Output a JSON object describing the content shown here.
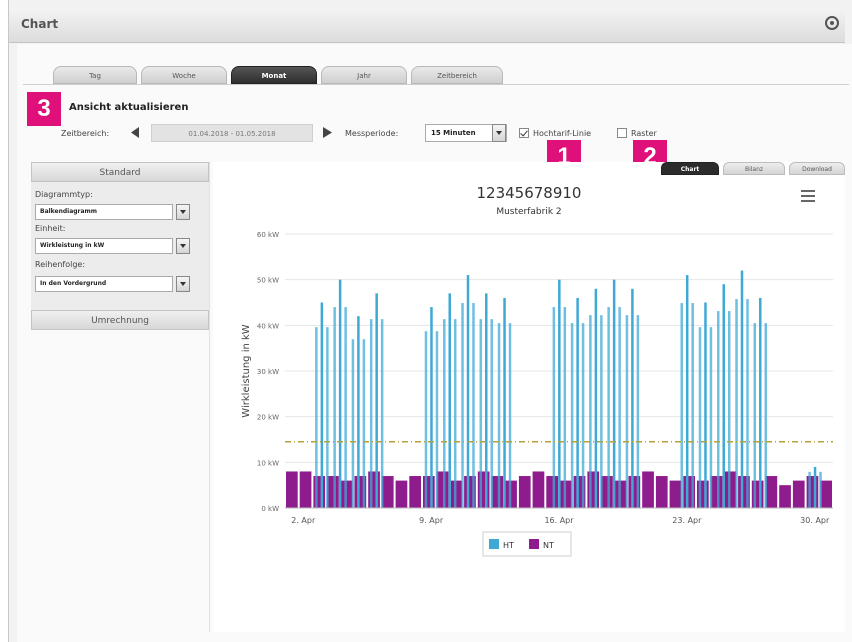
{
  "window": {
    "title": "Chart"
  },
  "tabs": [
    {
      "label": "Tag",
      "active": false
    },
    {
      "label": "Woche",
      "active": false
    },
    {
      "label": "Monat",
      "active": true
    },
    {
      "label": "Jahr",
      "active": false
    },
    {
      "label": "Zeitbereich",
      "active": false
    }
  ],
  "badges": {
    "b1": "1",
    "b2": "2",
    "b3": "3"
  },
  "refresh": {
    "label": "Ansicht aktualisieren"
  },
  "controls": {
    "zeitbereich_label": "Zeitbereich:",
    "zeitbereich_value": "01.04.2018 - 01.05.2018",
    "messperiode_label": "Messperiode:",
    "messperiode_value": "15 Minuten",
    "checkbox1_label": "Hochtarif-Linie",
    "checkbox1_checked": true,
    "checkbox2_label": "Raster",
    "checkbox2_checked": false
  },
  "sidebar": {
    "header": "Standard",
    "diagrammtyp_label": "Diagrammtyp:",
    "diagrammtyp_value": "Balkendiagramm",
    "einheit_label": "Einheit:",
    "einheit_value": "Wirkleistung in kW",
    "reihenfolge_label": "Reihenfolge:",
    "reihenfolge_value": "In den Vordergrund",
    "footer": "Umrechnung"
  },
  "chart_tabs": [
    {
      "label": "Chart",
      "active": true
    },
    {
      "label": "Bilanz",
      "active": false
    },
    {
      "label": "Download",
      "active": false
    }
  ],
  "colors": {
    "ht": "#3fa9d6",
    "nt": "#8e1c8c",
    "threshold": "#b5a23a",
    "accent": "#e0107a"
  },
  "chart_data": {
    "type": "bar",
    "title": "12345678910",
    "subtitle": "Musterfabrik 2",
    "ylabel": "Wirkleistung in kW",
    "ylim": [
      0,
      60
    ],
    "yticks": [
      "0 kW",
      "10 kW",
      "20 kW",
      "30 kW",
      "40 kW",
      "50 kW",
      "60 kW"
    ],
    "xticks": [
      "2. Apr",
      "9. Apr",
      "16. Apr",
      "23. Apr",
      "30. Apr"
    ],
    "xticks_day": [
      2,
      9,
      16,
      23,
      30
    ],
    "xlim_day": [
      1,
      31
    ],
    "threshold": 14.5,
    "legend": [
      "HT",
      "NT"
    ],
    "series": [
      {
        "name": "HT",
        "days": [
          3,
          4,
          5,
          6,
          9,
          10,
          11,
          12,
          13,
          16,
          17,
          18,
          19,
          20,
          23,
          24,
          25,
          26,
          27,
          30
        ],
        "peaks": [
          45,
          50,
          42,
          47,
          44,
          47,
          51,
          47,
          46,
          50,
          46,
          48,
          50,
          48,
          51,
          45,
          49,
          52,
          46,
          9
        ]
      },
      {
        "name": "NT",
        "values": [
          8,
          8,
          7,
          7,
          6,
          7,
          8,
          7,
          6,
          7,
          7,
          8,
          6,
          7,
          8,
          7,
          6,
          7,
          8,
          7,
          6,
          7,
          8,
          7,
          6,
          7,
          8,
          7,
          6,
          7,
          6,
          7,
          8,
          7,
          6,
          7,
          5,
          6,
          7,
          6
        ]
      }
    ]
  }
}
